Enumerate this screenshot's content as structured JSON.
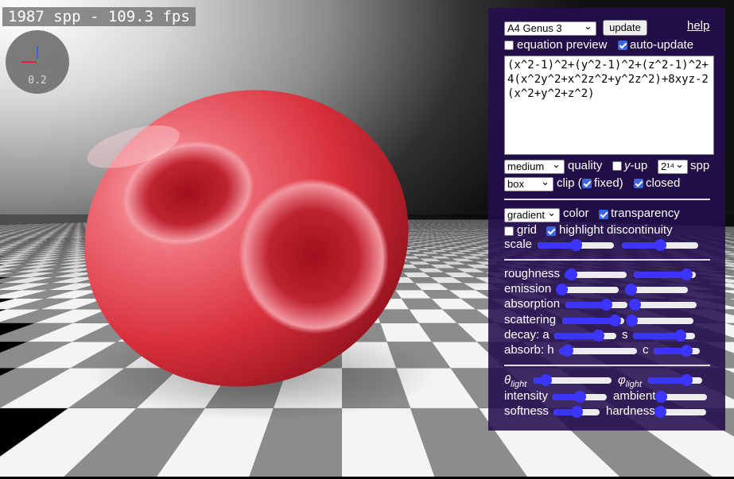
{
  "hud": {
    "fps_text": "1987 spp - 109.3 fps",
    "axis_value": "0.2"
  },
  "panel": {
    "preset": "A4 Genus 3",
    "update_label": "update",
    "help_label": "help",
    "equation_preview_label": "equation preview",
    "equation_preview_checked": false,
    "auto_update_label": "auto-update",
    "auto_update_checked": true,
    "equation": "(x^2-1)^2+(y^2-1)^2+(z^2-1)^2+4(x^2y^2+x^2z^2+y^2z^2)+8xyz-2(x^2+y^2+z^2)",
    "quality_select": "medium",
    "quality_label": "quality",
    "y_up_var": "y",
    "y_up_suffix": "-up",
    "y_up_checked": false,
    "spp_select": "2¹⁴",
    "spp_label": "spp",
    "clip_select": "box",
    "clip_label": "clip (",
    "fixed_label": "fixed)",
    "fixed_checked": true,
    "closed_label": "closed",
    "closed_checked": true,
    "color_select": "gradient",
    "color_label": "color",
    "transparency_label": "transparency",
    "transparency_checked": true,
    "grid_label": "grid",
    "grid_checked": false,
    "highlight_label": "highlight discontinuity",
    "highlight_checked": true,
    "scale_label": "scale",
    "roughness_label": "roughness",
    "emission_label": "emission",
    "absorption_label": "absorption",
    "scattering_label": "scattering",
    "decay_label": "decay: a",
    "decay_s_label": "s",
    "absorb_label": "absorb: h",
    "absorb_c_label": "c",
    "theta_symbol": "θ",
    "phi_symbol": "φ",
    "light_sub": "light",
    "intensity_label": "intensity",
    "ambient_label": "ambient",
    "softness_label": "softness",
    "hardness_label": "hardness"
  },
  "sliders": {
    "scale_1": 0.5,
    "scale_2": 0.5,
    "roughness_1": 0.1,
    "roughness_2": 0.85,
    "emission_1": 0.0,
    "emission_2": 0.0,
    "absorption_1": 0.65,
    "absorption_2": 0.0,
    "scattering_1": 0.85,
    "scattering_2": 0.0,
    "decay_a": 0.7,
    "decay_s": 0.75,
    "absorb_h": 0.1,
    "absorb_c": 0.7,
    "theta_light": 0.15,
    "phi_light": 0.7,
    "intensity": 0.5,
    "ambient": 0.0,
    "softness": 0.5,
    "hardness": 0.0
  },
  "colors": {
    "panel_bg": "#230c50",
    "accent": "#3b35ff",
    "checkbox_on": "#3b66e0",
    "surface_red": "#e0404a",
    "surface_highlight": "#f6a6b0",
    "floor_light": "#f4f4f4",
    "floor_dark": "#8c8c8c",
    "axis_x": "#e02040",
    "axis_y": "#3060ff",
    "axis_z": "#30c030"
  },
  "icons": {
    "axis_widget": "axis-gizmo-icon",
    "dropdown": "chevron-down-icon"
  }
}
